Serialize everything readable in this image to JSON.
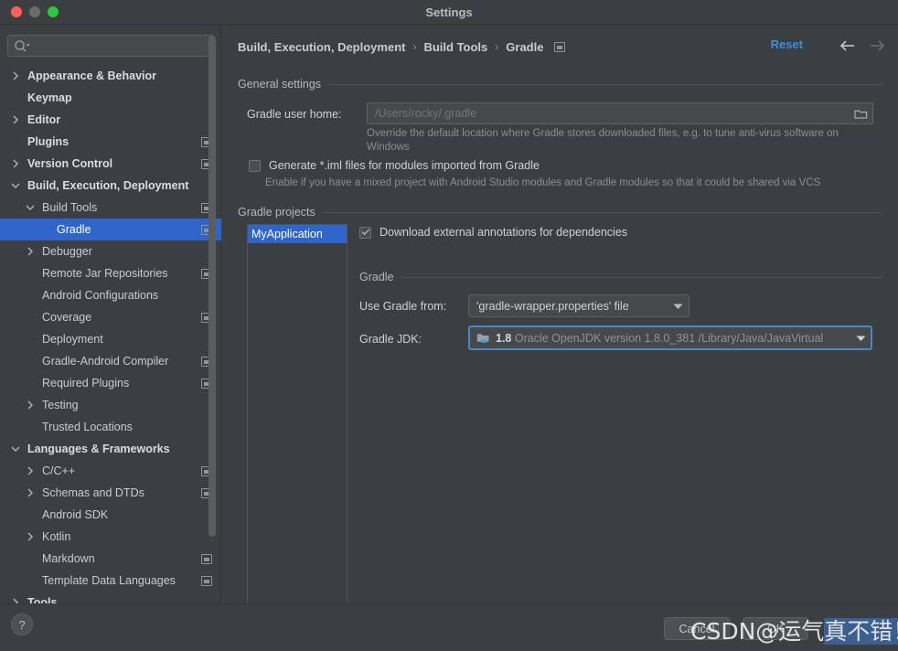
{
  "window": {
    "title": "Settings",
    "controls": [
      "close",
      "minimize",
      "zoom"
    ]
  },
  "sidebar": {
    "search": {
      "value": "",
      "placeholder": ""
    },
    "items": [
      {
        "label": "Appearance & Behavior",
        "indent": 0,
        "arrow": "right",
        "bold": true,
        "badge": false,
        "selected": false
      },
      {
        "label": "Keymap",
        "indent": 0,
        "arrow": "none",
        "bold": true,
        "badge": false,
        "selected": false
      },
      {
        "label": "Editor",
        "indent": 0,
        "arrow": "right",
        "bold": true,
        "badge": false,
        "selected": false
      },
      {
        "label": "Plugins",
        "indent": 0,
        "arrow": "none",
        "bold": true,
        "badge": true,
        "selected": false
      },
      {
        "label": "Version Control",
        "indent": 0,
        "arrow": "right",
        "bold": true,
        "badge": true,
        "selected": false
      },
      {
        "label": "Build, Execution, Deployment",
        "indent": 0,
        "arrow": "down",
        "bold": true,
        "badge": false,
        "selected": false
      },
      {
        "label": "Build Tools",
        "indent": 1,
        "arrow": "down",
        "bold": false,
        "badge": true,
        "selected": false
      },
      {
        "label": "Gradle",
        "indent": 2,
        "arrow": "none",
        "bold": false,
        "badge": true,
        "selected": true
      },
      {
        "label": "Debugger",
        "indent": 1,
        "arrow": "right",
        "bold": false,
        "badge": false,
        "selected": false
      },
      {
        "label": "Remote Jar Repositories",
        "indent": 1,
        "arrow": "none",
        "bold": false,
        "badge": true,
        "selected": false
      },
      {
        "label": "Android Configurations",
        "indent": 1,
        "arrow": "none",
        "bold": false,
        "badge": false,
        "selected": false
      },
      {
        "label": "Coverage",
        "indent": 1,
        "arrow": "none",
        "bold": false,
        "badge": true,
        "selected": false
      },
      {
        "label": "Deployment",
        "indent": 1,
        "arrow": "none",
        "bold": false,
        "badge": false,
        "selected": false
      },
      {
        "label": "Gradle-Android Compiler",
        "indent": 1,
        "arrow": "none",
        "bold": false,
        "badge": true,
        "selected": false
      },
      {
        "label": "Required Plugins",
        "indent": 1,
        "arrow": "none",
        "bold": false,
        "badge": true,
        "selected": false
      },
      {
        "label": "Testing",
        "indent": 1,
        "arrow": "right",
        "bold": false,
        "badge": false,
        "selected": false
      },
      {
        "label": "Trusted Locations",
        "indent": 1,
        "arrow": "none",
        "bold": false,
        "badge": false,
        "selected": false
      },
      {
        "label": "Languages & Frameworks",
        "indent": 0,
        "arrow": "down",
        "bold": true,
        "badge": false,
        "selected": false
      },
      {
        "label": "C/C++",
        "indent": 1,
        "arrow": "right",
        "bold": false,
        "badge": true,
        "selected": false
      },
      {
        "label": "Schemas and DTDs",
        "indent": 1,
        "arrow": "right",
        "bold": false,
        "badge": true,
        "selected": false
      },
      {
        "label": "Android SDK",
        "indent": 1,
        "arrow": "none",
        "bold": false,
        "badge": false,
        "selected": false
      },
      {
        "label": "Kotlin",
        "indent": 1,
        "arrow": "right",
        "bold": false,
        "badge": false,
        "selected": false
      },
      {
        "label": "Markdown",
        "indent": 1,
        "arrow": "none",
        "bold": false,
        "badge": true,
        "selected": false
      },
      {
        "label": "Template Data Languages",
        "indent": 1,
        "arrow": "none",
        "bold": false,
        "badge": true,
        "selected": false
      },
      {
        "label": "Tools",
        "indent": 0,
        "arrow": "right",
        "bold": true,
        "badge": false,
        "selected": false
      }
    ]
  },
  "header": {
    "breadcrumb": [
      "Build, Execution, Deployment",
      "Build Tools",
      "Gradle"
    ],
    "separator": "›",
    "reset_label": "Reset",
    "back_icon": "arrow-left-icon",
    "forward_icon": "arrow-right-icon"
  },
  "main": {
    "general_section_title": "General settings",
    "gradle_user_home": {
      "label": "Gradle user home:",
      "value": "",
      "placeholder": "/Users/rocky/.gradle",
      "browse_icon": "folder-icon"
    },
    "gradle_user_home_hint": "Override the default location where Gradle stores downloaded files, e.g. to tune anti-virus software on Windows",
    "generate_iml": {
      "label": "Generate *.iml files for modules imported from Gradle",
      "checked": false
    },
    "generate_iml_hint": "Enable if you have a mixed project with Android Studio modules and Gradle modules so that it could be shared via VCS",
    "projects_section_title": "Gradle projects",
    "project_list": [
      {
        "name": "MyApplication",
        "selected": true
      }
    ],
    "download_annotations": {
      "label": "Download external annotations for dependencies",
      "checked": true
    },
    "gradle_subsection_title": "Gradle",
    "use_gradle_from": {
      "label": "Use Gradle from:",
      "value": "'gradle-wrapper.properties' file"
    },
    "gradle_jdk": {
      "label": "Gradle JDK:",
      "version": "1.8",
      "description": "Oracle OpenJDK version 1.8.0_381 /Library/Java/JavaVirtual",
      "icon": "jdk-folder-icon",
      "focused": true
    }
  },
  "footer": {
    "help_label": "?",
    "cancel_label": "Cancel",
    "ok_label": "OK"
  },
  "watermark": {
    "prefix": "CSDN@运气",
    "highlighted": "真不错！"
  },
  "colors": {
    "window_bg": "#3c3f41",
    "selection_blue": "#2f65ca",
    "accent_link": "#3a8ee6",
    "focus_border": "#4a88c7",
    "text_primary": "#cfd3d6",
    "text_muted": "#8b8f92",
    "field_bg": "#45494a"
  }
}
